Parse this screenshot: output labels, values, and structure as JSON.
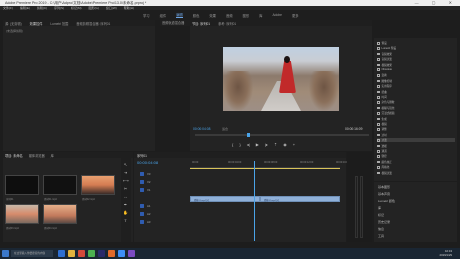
{
  "window": {
    "title": "Adobe Premiere Pro 2019 - C:\\用户\\Adpro\\文档\\Adobe\\Premiere Pro\\13.0\\未命名.prproj *"
  },
  "menu": [
    "文件(F)",
    "编辑(E)",
    "剪辑(C)",
    "序列(S)",
    "标记(M)",
    "图形(G)",
    "窗口(W)",
    "帮助(H)"
  ],
  "workspaces": [
    "学习",
    "组件",
    "编辑",
    "颜色",
    "效果",
    "音频",
    "图形",
    "库",
    "Adobe",
    "更多"
  ],
  "active_workspace": "编辑",
  "source_panel": {
    "tabs": [
      "源: (无剪辑)",
      "效果控件",
      "Lumetri 范围",
      "音频剪辑混合器: 序列01"
    ],
    "active": "效果控件",
    "header": "(未选择剪辑)"
  },
  "mixer_tab": "音频轨道混合器",
  "program_panel": {
    "tabs": [
      "节目: 序列01",
      "参考: 序列01"
    ],
    "active": "节目: 序列01",
    "timecode_left": "00:00:04:08",
    "fit": "适合",
    "timecode_right": "00:00:16:09"
  },
  "right_panel_tree": [
    {
      "label": "预设",
      "sel": false
    },
    {
      "label": "Lumetri 预设",
      "sel": false
    },
    {
      "label": "音频效果",
      "sel": false
    },
    {
      "label": "音频过渡",
      "sel": false
    },
    {
      "label": "视频效果",
      "sel": false
    },
    {
      "label": "Obsolete",
      "sel": false
    },
    {
      "label": "变换",
      "sel": false
    },
    {
      "label": "图像控制",
      "sel": false
    },
    {
      "label": "实用程序",
      "sel": false
    },
    {
      "label": "扭曲",
      "sel": false
    },
    {
      "label": "时间",
      "sel": false
    },
    {
      "label": "杂色与颗粒",
      "sel": false
    },
    {
      "label": "模糊与锐化",
      "sel": false
    },
    {
      "label": "沉浸式视频",
      "sel": false
    },
    {
      "label": "生成",
      "sel": false
    },
    {
      "label": "视频",
      "sel": false
    },
    {
      "label": "调整",
      "sel": false
    },
    {
      "label": "过时",
      "sel": false
    },
    {
      "label": "过渡",
      "sel": true
    },
    {
      "label": "透视",
      "sel": false
    },
    {
      "label": "通道",
      "sel": false
    },
    {
      "label": "键控",
      "sel": false
    },
    {
      "label": "颜色校正",
      "sel": false
    },
    {
      "label": "风格化",
      "sel": false
    },
    {
      "label": "视频过渡",
      "sel": false
    }
  ],
  "effects_list": [
    "基本图形",
    "基本声音",
    "Lumetri 颜色",
    "库",
    "标记",
    "历史记录",
    "信息",
    "工具"
  ],
  "project_panel": {
    "tabs": [
      "项目: 未命名",
      "媒体浏览器",
      "库"
    ],
    "active": "项目: 未命名",
    "items": [
      "序列01",
      "素材01.mp4",
      "素材02.mp4",
      "素材03.mp4",
      "素材04.mp4"
    ]
  },
  "timeline": {
    "tabs": [
      "序列01"
    ],
    "active": "序列01",
    "timecode": "00:00:04:08",
    "ruler": [
      "00:00",
      "00:00:04:00",
      "00:00:08:00",
      "00:00:12:00",
      "00:00:16:00"
    ],
    "tracks": [
      "V3",
      "V2",
      "V1",
      "A1",
      "A2",
      "A3"
    ],
    "clips": [
      "素材01.mp4 [V]",
      "素材02.mp4 [V]"
    ]
  },
  "taskbar": {
    "search": "在这里输入你要搜索的内容",
    "time": "10:43",
    "date": "2019/1/29"
  }
}
